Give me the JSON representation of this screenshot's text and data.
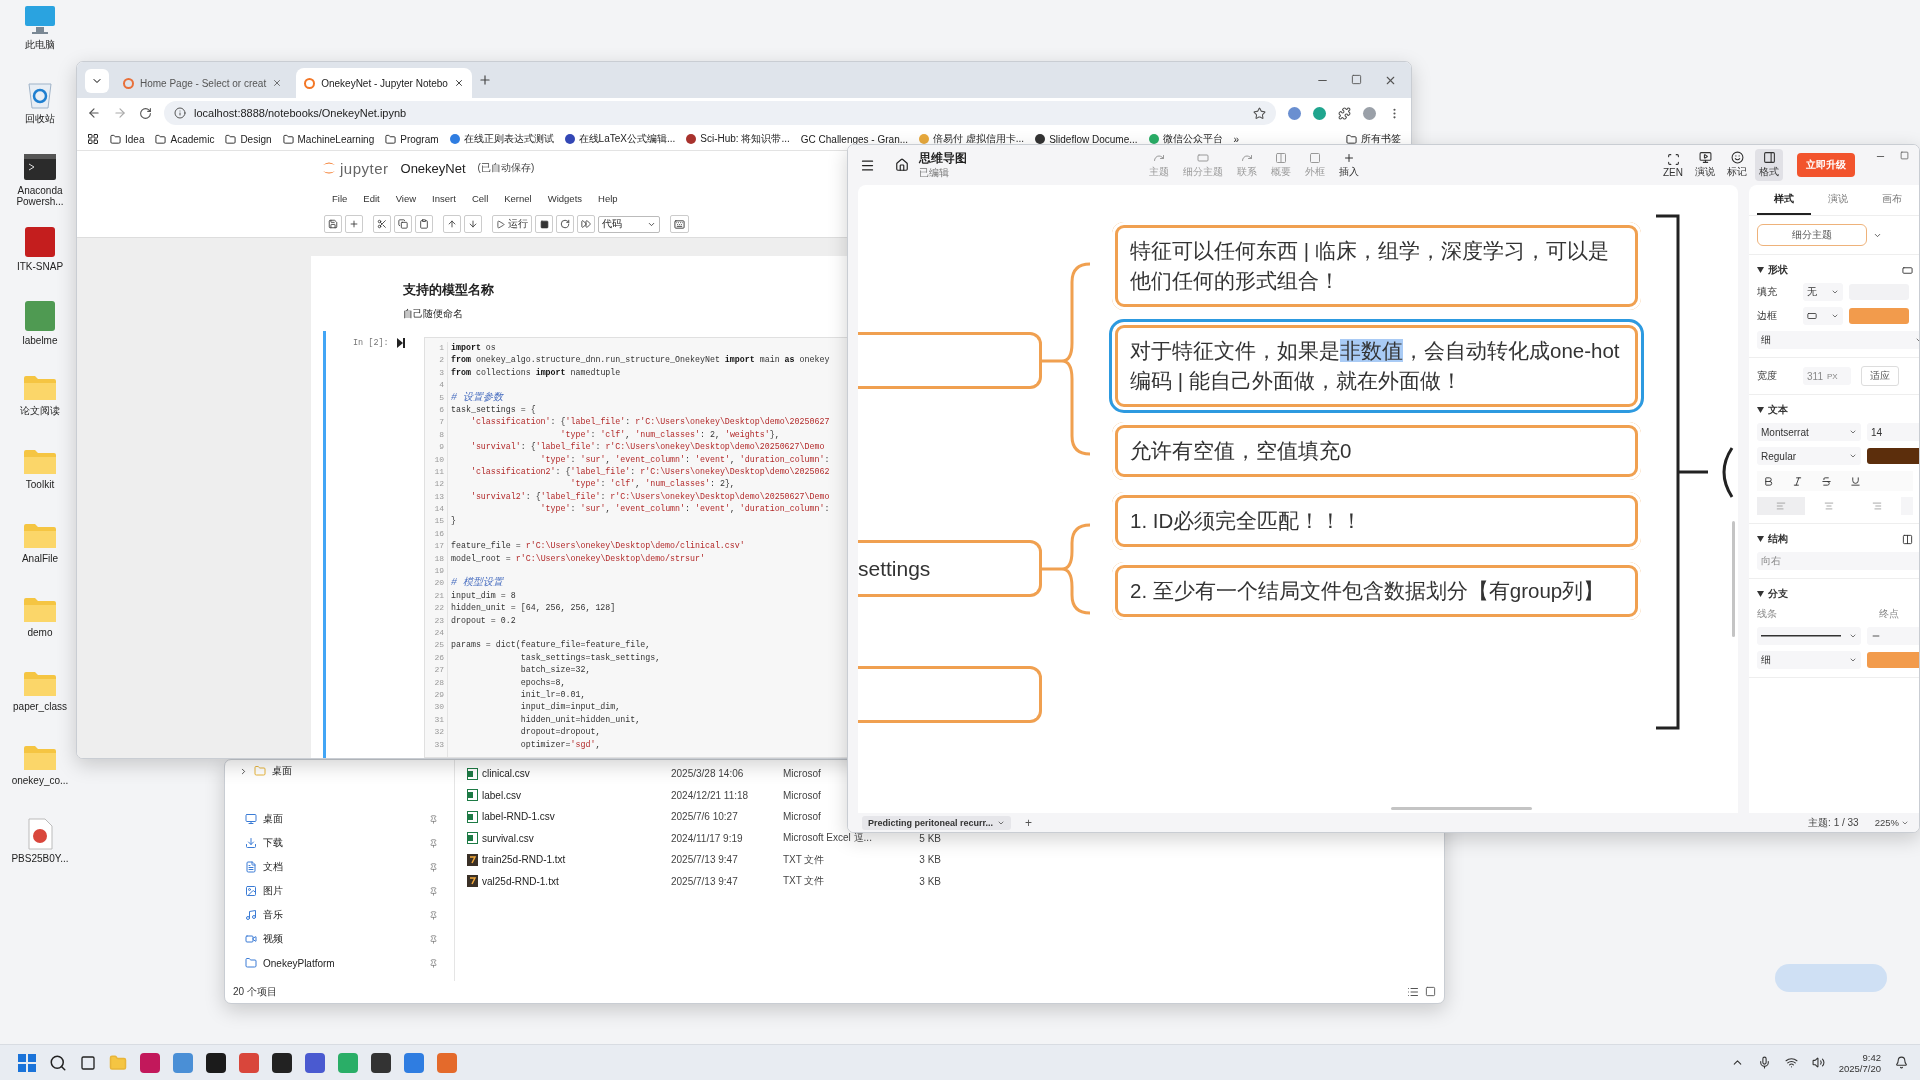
{
  "desktop_icons": [
    {
      "label": "此电脑",
      "kind": "computer"
    },
    {
      "label": "回收站",
      "kind": "recycle-bin"
    },
    {
      "label": "Anaconda Powersh...",
      "kind": "terminal"
    },
    {
      "label": "ITK-SNAP",
      "kind": "app",
      "color": "#c41e1e"
    },
    {
      "label": "labelme",
      "kind": "app",
      "color": "#4f9a52"
    },
    {
      "label": "论文阅读",
      "kind": "folder"
    },
    {
      "label": "Toolkit",
      "kind": "folder"
    },
    {
      "label": "AnalFile",
      "kind": "folder"
    },
    {
      "label": "demo",
      "kind": "folder"
    },
    {
      "label": "paper_class",
      "kind": "folder"
    },
    {
      "label": "onekey_co...",
      "kind": "folder"
    },
    {
      "label": "PBS25B0Y...",
      "kind": "document"
    }
  ],
  "browser": {
    "tabs": [
      {
        "title": "Home Page - Select or creat",
        "selected": false
      },
      {
        "title": "OnekeyNet - Jupyter Notebo",
        "selected": true
      }
    ],
    "url": "localhost:8888/notebooks/OnekeyNet.ipynb",
    "bookmarks": [
      {
        "label": "Idea",
        "kind": "folder"
      },
      {
        "label": "Academic",
        "kind": "folder"
      },
      {
        "label": "Design",
        "kind": "folder"
      },
      {
        "label": "MachineLearning",
        "kind": "folder"
      },
      {
        "label": "Program",
        "kind": "folder"
      },
      {
        "label": "在线正则表达式测试",
        "kind": "site",
        "color": "#2f7de1"
      },
      {
        "label": "在线LaTeX公式编辑...",
        "kind": "site",
        "color": "#3347b5"
      },
      {
        "label": "Sci-Hub: 将知识带...",
        "kind": "site",
        "color": "#a8322d"
      },
      {
        "label": "GC Challenges - Gran...",
        "kind": "plain"
      },
      {
        "label": "倍易付 虚拟信用卡...",
        "kind": "site",
        "color": "#e8a93c"
      },
      {
        "label": "Slideflow Docume...",
        "kind": "site",
        "color": "#333333"
      },
      {
        "label": "微信公众平台",
        "kind": "site",
        "color": "#2aae67"
      }
    ],
    "bookmarks_more": "»",
    "all_bookmarks": "所有书签"
  },
  "jupyter": {
    "logo": "jupyter",
    "notebook": "OnekeyNet",
    "save_status": "(已自动保存)",
    "menu": [
      "File",
      "Edit",
      "View",
      "Insert",
      "Cell",
      "Kernel",
      "Widgets",
      "Help"
    ],
    "run_label": "运行",
    "cell_type": "代码",
    "heading": "支持的模型名称",
    "subtext": "自己随便命名",
    "prompt": "In [2]:",
    "lines": [
      {
        "n": "1",
        "parts": [
          {
            "kind": "keyword",
            "text": "import"
          },
          {
            "kind": "plain",
            "text": " os"
          }
        ]
      },
      {
        "n": "2",
        "parts": [
          {
            "kind": "keyword",
            "text": "from"
          },
          {
            "kind": "plain",
            "text": " onekey_algo.structure_dnn.run_structure_OnekeyNet "
          },
          {
            "kind": "keyword",
            "text": "import"
          },
          {
            "kind": "plain",
            "text": " main "
          },
          {
            "kind": "keyword",
            "text": "as"
          },
          {
            "kind": "plain",
            "text": " onekey"
          }
        ]
      },
      {
        "n": "3",
        "parts": [
          {
            "kind": "keyword",
            "text": "from"
          },
          {
            "kind": "plain",
            "text": " collections "
          },
          {
            "kind": "keyword",
            "text": "import"
          },
          {
            "kind": "plain",
            "text": " namedtuple"
          }
        ]
      },
      {
        "n": "4"
      },
      {
        "n": "5",
        "parts": [
          {
            "kind": "comment",
            "text": "# 设置参数"
          }
        ]
      },
      {
        "n": "6",
        "parts": [
          {
            "kind": "plain",
            "text": "task_settings = {"
          }
        ]
      },
      {
        "n": "7",
        "parts": [
          {
            "kind": "string",
            "text": "    'classification'"
          },
          {
            "kind": "plain",
            "text": ": {"
          },
          {
            "kind": "string",
            "text": "'label_file'"
          },
          {
            "kind": "plain",
            "text": ": "
          },
          {
            "kind": "string",
            "text": "r'C:\\Users\\onekey\\Desktop\\demo\\20250627"
          }
        ]
      },
      {
        "n": "8",
        "parts": [
          {
            "kind": "string",
            "text": "                      'type'"
          },
          {
            "kind": "plain",
            "text": ": "
          },
          {
            "kind": "string",
            "text": "'clf'"
          },
          {
            "kind": "plain",
            "text": ", "
          },
          {
            "kind": "string",
            "text": "'num_classes'"
          },
          {
            "kind": "plain",
            "text": ": 2, "
          },
          {
            "kind": "string",
            "text": "'weights'"
          },
          {
            "kind": "plain",
            "text": "},"
          }
        ]
      },
      {
        "n": "9",
        "parts": [
          {
            "kind": "string",
            "text": "    'survival'"
          },
          {
            "kind": "plain",
            "text": ": {"
          },
          {
            "kind": "string",
            "text": "'label_file'"
          },
          {
            "kind": "plain",
            "text": ": "
          },
          {
            "kind": "string",
            "text": "r'C:\\Users\\onekey\\Desktop\\demo\\20250627\\Demo"
          }
        ]
      },
      {
        "n": "10",
        "parts": [
          {
            "kind": "string",
            "text": "                  'type'"
          },
          {
            "kind": "plain",
            "text": ": "
          },
          {
            "kind": "string",
            "text": "'sur'"
          },
          {
            "kind": "plain",
            "text": ", "
          },
          {
            "kind": "string",
            "text": "'event_column'"
          },
          {
            "kind": "plain",
            "text": ": "
          },
          {
            "kind": "string",
            "text": "'event'"
          },
          {
            "kind": "plain",
            "text": ", "
          },
          {
            "kind": "string",
            "text": "'duration_column'"
          },
          {
            "kind": "plain",
            "text": ":"
          }
        ]
      },
      {
        "n": "11",
        "parts": [
          {
            "kind": "string",
            "text": "    'classification2'"
          },
          {
            "kind": "plain",
            "text": ": {"
          },
          {
            "kind": "string",
            "text": "'label_file'"
          },
          {
            "kind": "plain",
            "text": ": "
          },
          {
            "kind": "string",
            "text": "r'C:\\Users\\onekey\\Desktop\\demo\\2025062"
          }
        ]
      },
      {
        "n": "12",
        "parts": [
          {
            "kind": "string",
            "text": "                        'type'"
          },
          {
            "kind": "plain",
            "text": ": "
          },
          {
            "kind": "string",
            "text": "'clf'"
          },
          {
            "kind": "plain",
            "text": ", "
          },
          {
            "kind": "string",
            "text": "'num_classes'"
          },
          {
            "kind": "plain",
            "text": ": 2},"
          }
        ]
      },
      {
        "n": "13",
        "parts": [
          {
            "kind": "string",
            "text": "    'survival2'"
          },
          {
            "kind": "plain",
            "text": ": {"
          },
          {
            "kind": "string",
            "text": "'label_file'"
          },
          {
            "kind": "plain",
            "text": ": "
          },
          {
            "kind": "string",
            "text": "r'C:\\Users\\onekey\\Desktop\\demo\\20250627\\Demo"
          }
        ]
      },
      {
        "n": "14",
        "parts": [
          {
            "kind": "string",
            "text": "                  'type'"
          },
          {
            "kind": "plain",
            "text": ": "
          },
          {
            "kind": "string",
            "text": "'sur'"
          },
          {
            "kind": "plain",
            "text": ", "
          },
          {
            "kind": "string",
            "text": "'event_column'"
          },
          {
            "kind": "plain",
            "text": ": "
          },
          {
            "kind": "string",
            "text": "'event'"
          },
          {
            "kind": "plain",
            "text": ", "
          },
          {
            "kind": "string",
            "text": "'duration_column'"
          },
          {
            "kind": "plain",
            "text": ":"
          }
        ]
      },
      {
        "n": "15",
        "parts": [
          {
            "kind": "plain",
            "text": "}"
          }
        ]
      },
      {
        "n": "16"
      },
      {
        "n": "17",
        "parts": [
          {
            "kind": "plain",
            "text": "feature_file = "
          },
          {
            "kind": "string",
            "text": "r'C:\\Users\\onekey\\Desktop\\demo/clinical.csv'"
          }
        ]
      },
      {
        "n": "18",
        "parts": [
          {
            "kind": "plain",
            "text": "model_root = "
          },
          {
            "kind": "string",
            "text": "r'C:\\Users\\onekey\\Desktop\\demo/strsur'"
          }
        ]
      },
      {
        "n": "19"
      },
      {
        "n": "20",
        "parts": [
          {
            "kind": "comment",
            "text": "# 模型设置"
          }
        ]
      },
      {
        "n": "21",
        "parts": [
          {
            "kind": "plain",
            "text": "input_dim = 8"
          }
        ]
      },
      {
        "n": "22",
        "parts": [
          {
            "kind": "plain",
            "text": "hidden_unit = [64, 256, 256, 128]"
          }
        ]
      },
      {
        "n": "23",
        "parts": [
          {
            "kind": "plain",
            "text": "dropout = 0.2"
          }
        ]
      },
      {
        "n": "24"
      },
      {
        "n": "25",
        "parts": [
          {
            "kind": "plain",
            "text": "params = dict(feature_file=feature_file,"
          }
        ]
      },
      {
        "n": "26",
        "parts": [
          {
            "kind": "plain",
            "text": "              task_settings=task_settings,"
          }
        ]
      },
      {
        "n": "27",
        "parts": [
          {
            "kind": "plain",
            "text": "              batch_size=32,"
          }
        ]
      },
      {
        "n": "28",
        "parts": [
          {
            "kind": "plain",
            "text": "              epochs=8,"
          }
        ]
      },
      {
        "n": "29",
        "parts": [
          {
            "kind": "plain",
            "text": "              init_lr=0.01,"
          }
        ]
      },
      {
        "n": "30",
        "parts": [
          {
            "kind": "plain",
            "text": "              input_dim=input_dim,"
          }
        ]
      },
      {
        "n": "31",
        "parts": [
          {
            "kind": "plain",
            "text": "              hidden_unit=hidden_unit,"
          }
        ]
      },
      {
        "n": "32",
        "parts": [
          {
            "kind": "plain",
            "text": "              dropout=dropout,"
          }
        ]
      },
      {
        "n": "33",
        "parts": [
          {
            "kind": "plain",
            "text": "              optimizer="
          },
          {
            "kind": "string",
            "text": "'sgd'"
          },
          {
            "kind": "plain",
            "text": ","
          }
        ]
      }
    ]
  },
  "mindmap": {
    "title": "思维导图",
    "status": "已编辑",
    "tools": [
      {
        "label": "主题",
        "disabled": true
      },
      {
        "label": "细分主题",
        "disabled": true
      },
      {
        "label": "联系",
        "disabled": true
      },
      {
        "label": "概要",
        "disabled": true
      },
      {
        "label": "外框",
        "disabled": true
      },
      {
        "label": "插入",
        "disabled": false
      }
    ],
    "views": [
      {
        "label": "ZEN",
        "selected": false
      },
      {
        "label": "演说",
        "selected": false
      },
      {
        "label": "标记",
        "selected": false
      },
      {
        "label": "格式",
        "selected": true
      }
    ],
    "upgrade": "立即升级",
    "left_nodes": [
      {
        "kind": "blank"
      },
      {
        "kind": "text",
        "text": "settings"
      },
      {
        "kind": "blank"
      }
    ],
    "topics": [
      {
        "selected": false,
        "segments": [
          {
            "text": "特征可以任何东西 | 临床，组学，深度学习，可以是他们任何的形式组合！",
            "highlighted": false
          }
        ]
      },
      {
        "selected": true,
        "segments": [
          {
            "text": "对于特征文件，如果是",
            "highlighted": false
          },
          {
            "text": "非数值",
            "highlighted": true
          },
          {
            "text": "，会自动转化成one-hot编码 | 能自己外面做，就在外面做！",
            "highlighted": false
          }
        ]
      },
      {
        "selected": false,
        "segments": [
          {
            "text": "允许有空值，空值填充0",
            "highlighted": false
          }
        ]
      },
      {
        "selected": false,
        "segments": [
          {
            "text": "1. ID必须完全匹配！！！",
            "highlighted": false
          }
        ]
      },
      {
        "selected": false,
        "segments": [
          {
            "text": "2. 至少有一个结局文件包含数据划分【有group列】",
            "highlighted": false
          }
        ]
      }
    ],
    "sheet_tab": "Predicting peritoneal recurr...",
    "add_sheet": "+",
    "topic_count": "主题: 1 / 33",
    "zoom": "225%",
    "panel": {
      "tabs": [
        {
          "label": "样式",
          "selected": true
        },
        {
          "label": "演说",
          "selected": false
        },
        {
          "label": "画布",
          "selected": false
        }
      ],
      "style_button": "细分主题",
      "shape": {
        "title": "形状",
        "expanded": true,
        "fill_label": "填充",
        "fill_value": "无",
        "border_label": "边框",
        "line_weight": "细",
        "width_label": "宽度",
        "width_value": "311",
        "width_unit": "PX",
        "fit_button": "适应"
      },
      "text": {
        "title": "文本",
        "expanded": true,
        "font": "Montserrat",
        "size": "14",
        "weight": "Regular"
      },
      "structure": {
        "title": "结构",
        "expanded": true,
        "direction": "向右"
      },
      "branch": {
        "title": "分支",
        "expanded": true,
        "line_label": "线条",
        "end_label": "终点",
        "weight": "细"
      }
    }
  },
  "explorer": {
    "nav": [
      {
        "label": "桌面",
        "kind": "tree"
      },
      {
        "label": "桌面",
        "kind": "desktop"
      },
      {
        "label": "下载",
        "kind": "downloads"
      },
      {
        "label": "文档",
        "kind": "documents"
      },
      {
        "label": "图片",
        "kind": "pictures"
      },
      {
        "label": "音乐",
        "kind": "music"
      },
      {
        "label": "视频",
        "kind": "videos"
      },
      {
        "label": "OnekeyPlatform",
        "kind": "folder"
      }
    ],
    "files": [
      {
        "name": "clinical.csv",
        "kind": "csv",
        "modified": "2025/3/28 14:06",
        "type": "Microsof"
      },
      {
        "name": "label.csv",
        "kind": "csv",
        "modified": "2024/12/21 11:18",
        "type": "Microsof"
      },
      {
        "name": "label-RND-1.csv",
        "kind": "csv",
        "modified": "2025/7/6 10:27",
        "type": "Microsof"
      },
      {
        "name": "survival.csv",
        "kind": "csv",
        "modified": "2024/11/17 9:19",
        "type": "Microsoft Excel 逗...",
        "size": "5 KB"
      },
      {
        "name": "train25d-RND-1.txt",
        "kind": "txt",
        "modified": "2025/7/13 9:47",
        "type": "TXT 文件",
        "size": "3 KB"
      },
      {
        "name": "val25d-RND-1.txt",
        "kind": "txt",
        "modified": "2025/7/13 9:47",
        "type": "TXT 文件",
        "size": "3 KB"
      }
    ],
    "item_count": "20 个项目"
  },
  "taskbar": {
    "time": "9:42",
    "date": "2025/7/20"
  }
}
